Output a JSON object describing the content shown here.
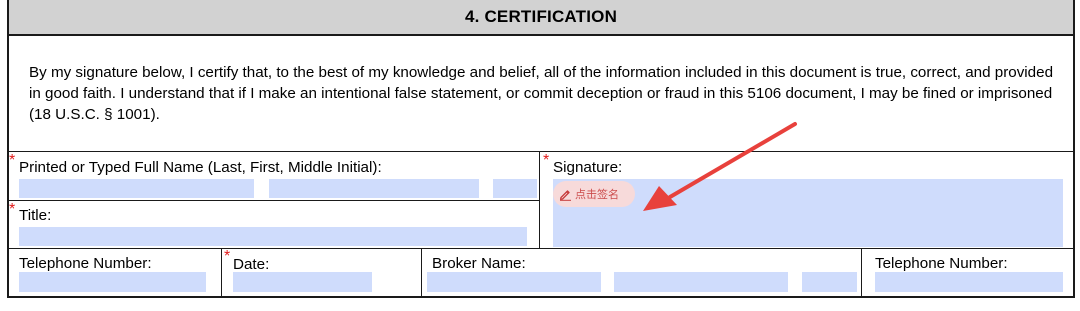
{
  "section": {
    "title": "4. CERTIFICATION"
  },
  "certification_text": "By my signature below, I certify that, to the best of my knowledge and belief, all of the information included in this document is true, correct, and provided in good faith.  I understand that if I make an intentional false statement, or commit deception or fraud in this 5106 document, I may be fined or imprisoned (18 U.S.C. § 1001).",
  "fields": {
    "full_name_label": "Printed or Typed Full Name (Last, First, Middle Initial):",
    "signature_label": "Signature:",
    "title_label": "Title:",
    "telephone_label": "Telephone Number:",
    "date_label": "Date:",
    "broker_name_label": "Broker Name:",
    "broker_telephone_label": "Telephone Number:",
    "required_marker": "*"
  },
  "sign_button": {
    "label": "点击签名",
    "icon": "pen-icon"
  },
  "colors": {
    "field_fill": "#cfdcfc",
    "required": "#e21b1b",
    "header_bg": "#d2d2d2",
    "arrow": "#e8413c"
  }
}
